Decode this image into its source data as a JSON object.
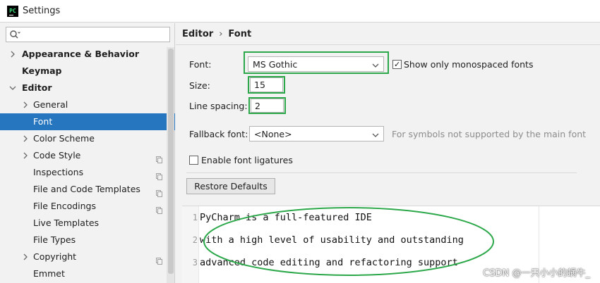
{
  "window": {
    "title": "Settings",
    "app_icon_text": "PC"
  },
  "sidebar": {
    "search_placeholder": "",
    "items": [
      {
        "label": "Appearance & Behavior",
        "level": 0,
        "arrow": "right",
        "bold": true,
        "selected": false,
        "copy_icon": false
      },
      {
        "label": "Keymap",
        "level": 0,
        "arrow": "none",
        "bold": true,
        "selected": false,
        "copy_icon": false
      },
      {
        "label": "Editor",
        "level": 0,
        "arrow": "down",
        "bold": true,
        "selected": false,
        "copy_icon": false
      },
      {
        "label": "General",
        "level": 1,
        "arrow": "right",
        "bold": false,
        "selected": false,
        "copy_icon": false
      },
      {
        "label": "Font",
        "level": 1,
        "arrow": "none",
        "bold": false,
        "selected": true,
        "copy_icon": false
      },
      {
        "label": "Color Scheme",
        "level": 1,
        "arrow": "right",
        "bold": false,
        "selected": false,
        "copy_icon": false
      },
      {
        "label": "Code Style",
        "level": 1,
        "arrow": "right",
        "bold": false,
        "selected": false,
        "copy_icon": true
      },
      {
        "label": "Inspections",
        "level": 1,
        "arrow": "none",
        "bold": false,
        "selected": false,
        "copy_icon": true
      },
      {
        "label": "File and Code Templates",
        "level": 1,
        "arrow": "none",
        "bold": false,
        "selected": false,
        "copy_icon": true
      },
      {
        "label": "File Encodings",
        "level": 1,
        "arrow": "none",
        "bold": false,
        "selected": false,
        "copy_icon": true
      },
      {
        "label": "Live Templates",
        "level": 1,
        "arrow": "none",
        "bold": false,
        "selected": false,
        "copy_icon": false
      },
      {
        "label": "File Types",
        "level": 1,
        "arrow": "none",
        "bold": false,
        "selected": false,
        "copy_icon": false
      },
      {
        "label": "Copyright",
        "level": 1,
        "arrow": "right",
        "bold": false,
        "selected": false,
        "copy_icon": true
      },
      {
        "label": "Emmet",
        "level": 1,
        "arrow": "none",
        "bold": false,
        "selected": false,
        "copy_icon": false
      }
    ]
  },
  "main": {
    "breadcrumb": {
      "parent": "Editor",
      "separator": "›",
      "current": "Font"
    },
    "font": {
      "label": "Font:",
      "value": "MS Gothic"
    },
    "show_monospaced": {
      "label": "Show only monospaced fonts",
      "checked": true,
      "check_glyph": "✓"
    },
    "size": {
      "label": "Size:",
      "value": "15"
    },
    "line_spacing": {
      "label": "Line spacing:",
      "value": "2"
    },
    "fallback": {
      "label": "Fallback font:",
      "value": "<None>",
      "hint": "For symbols not supported by the main font"
    },
    "ligatures": {
      "label": "Enable font ligatures",
      "checked": false
    },
    "restore_button": "Restore Defaults",
    "preview": {
      "lines": [
        {
          "num": "1",
          "text": "PyCharm is a full-featured IDE"
        },
        {
          "num": "2",
          "text": "with a high level of usability and outstanding"
        },
        {
          "num": "3",
          "text": "advanced code editing and refactoring support"
        }
      ]
    },
    "watermark": "CSDN @一只小小的蜗牛_"
  },
  "colors": {
    "selection": "#2675bf",
    "highlight_box": "#2ca84a",
    "ellipse": "#2ca84a",
    "hint_text": "#8c8c8c"
  },
  "icons": {
    "app": "pycharm-icon",
    "search": "search-icon",
    "expand": "chevron-right-icon",
    "collapse": "chevron-down-icon",
    "dropdown": "chevron-down-icon",
    "project_scope": "copy-icon"
  }
}
